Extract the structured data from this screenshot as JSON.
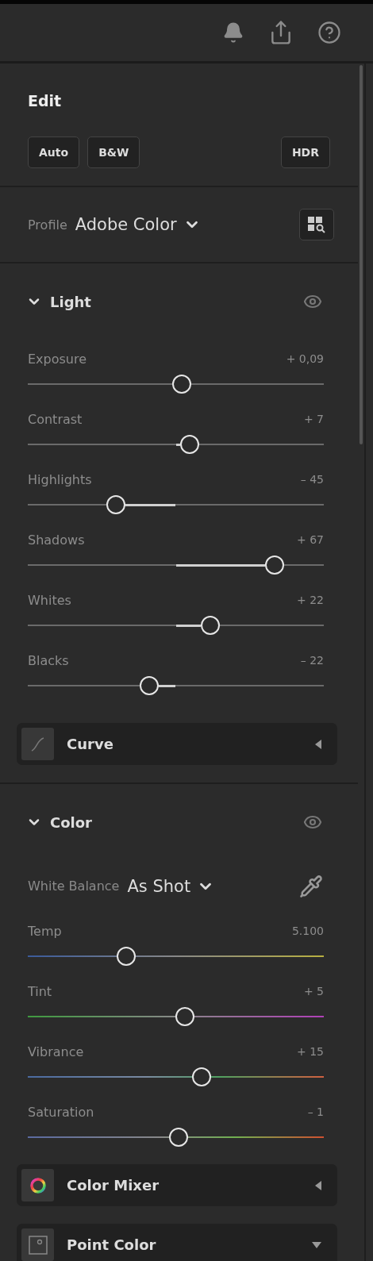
{
  "header": {
    "icons": [
      {
        "kind": "notifications"
      },
      {
        "kind": "share"
      },
      {
        "kind": "help"
      }
    ]
  },
  "edit": {
    "title": "Edit",
    "buttons": [
      {
        "label": "Auto"
      },
      {
        "label": "B&W"
      },
      {
        "label": "HDR"
      }
    ]
  },
  "profile": {
    "label": "Profile",
    "value": "Adobe Color"
  },
  "sections": [
    {
      "title": "Light",
      "expanded": true,
      "sliders": [
        {
          "label": "Exposure",
          "reading": "+ 0,09",
          "level": 0.52,
          "kind": "neutral"
        },
        {
          "label": "Contrast",
          "reading": "+ 7",
          "level": 0.546,
          "kind": "neutral"
        },
        {
          "label": "Highlights",
          "reading": "– 45",
          "level": 0.298,
          "kind": "neutral"
        },
        {
          "label": "Shadows",
          "reading": "+ 67",
          "level": 0.834,
          "kind": "neutral"
        },
        {
          "label": "Whites",
          "reading": "+ 22",
          "level": 0.617,
          "kind": "neutral"
        },
        {
          "label": "Blacks",
          "reading": "– 22",
          "level": 0.409,
          "kind": "neutral"
        }
      ],
      "cards": [
        {
          "title": "Curve",
          "kind": "curve",
          "expanded": false
        }
      ]
    },
    {
      "title": "Color",
      "expanded": true,
      "row": {
        "label": "White Balance",
        "value": "As Shot"
      },
      "sliders": [
        {
          "label": "Temp",
          "reading": "5.100",
          "level": 0.332,
          "kind": "temp"
        },
        {
          "label": "Tint",
          "reading": "+ 5",
          "level": 0.53,
          "kind": "tint"
        },
        {
          "label": "Vibrance",
          "reading": "+ 15",
          "level": 0.586,
          "kind": "vibrance"
        },
        {
          "label": "Saturation",
          "reading": "– 1",
          "level": 0.509,
          "kind": "saturation"
        }
      ],
      "cards": [
        {
          "title": "Color Mixer",
          "kind": "mixer",
          "expanded": false
        },
        {
          "title": "Point Color",
          "kind": "point",
          "expanded": true
        }
      ]
    }
  ]
}
